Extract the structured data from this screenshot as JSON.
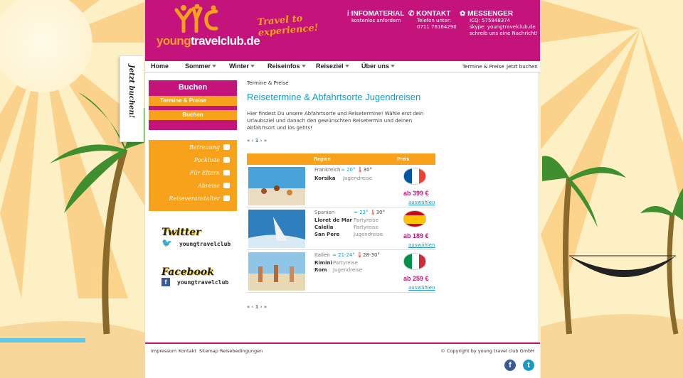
{
  "brand": {
    "logo_left": "young",
    "logo_mid": "travel",
    "logo_right": "club.de",
    "slogan": "Travel to experience!"
  },
  "header": {
    "info": {
      "title": "INFOMATERIAL",
      "sub": "kostenlos anfordern"
    },
    "contact": {
      "title": "KONTAKT",
      "line1": "Telefon unter:",
      "line2": "0711 76164290"
    },
    "messenger": {
      "title": "MESSENGER",
      "line1": "ICQ: 575848374",
      "line2": "skype: youngtravelclub.de",
      "line3": "schreib uns eine Nachricht!"
    }
  },
  "nav": {
    "items": [
      "Home",
      "Sommer",
      "Winter",
      "Reiseinfos",
      "Reiseziel",
      "Über uns"
    ],
    "right": [
      "Termine & Preise",
      "Jetzt buchen"
    ]
  },
  "side_tab": "Jetzt buchen!",
  "sidebar": {
    "book_title": "Buchen",
    "book_items": [
      "Termine & Preise",
      "Buchen"
    ],
    "info_items": [
      "Betreuung",
      "Packliste",
      "Für Eltern",
      "Abreise",
      "Reiseveranstalter"
    ],
    "twitter": {
      "title": "Twitter",
      "handle": "youngtravelclub"
    },
    "facebook": {
      "title": "Facebook",
      "handle": "youngtravelclub"
    }
  },
  "content": {
    "breadcrumb": "Termine & Preise",
    "title": "Reisetermine & Abfahrtsorte Jugendreisen",
    "intro": "Hier findest Du unsere Abfahrtsorte und Reisetermine! Wähle erst dein Urlaubsziel und danach den gewünschten Reisetermin und deinen Abfahrtsort und los gehts!",
    "pager": {
      "first": "«",
      "prev": "‹",
      "current": "1",
      "next": "›",
      "last": "»"
    },
    "table": {
      "col_region": "Region",
      "col_price": "Preis",
      "rows": [
        {
          "country": "Frankreich",
          "water": "≈ 20°",
          "air": "30°",
          "dests": [
            {
              "name": "Korsika",
              "type": "Jugendreise"
            }
          ],
          "price": "ab 399 €",
          "choose": "auswählen",
          "flag": [
            "#0055a4",
            "#ffffff",
            "#ef4135"
          ]
        },
        {
          "country": "Spanien",
          "water": "≈ 23°",
          "air": "30°",
          "dests": [
            {
              "name": "Lloret de Mar",
              "type": "Partyreise"
            },
            {
              "name": "Calella",
              "type": "Partyreise"
            },
            {
              "name": "San Pere",
              "type": "Jugendreise"
            }
          ],
          "price": "ab 189 €",
          "choose": "auswählen",
          "flag": [
            "#c60b1e",
            "#ffc400",
            "#c60b1e"
          ]
        },
        {
          "country": "Italien",
          "water": "≈ 21-24°",
          "air": "28-30°",
          "dests": [
            {
              "name": "Rimini",
              "type": "Partyreise"
            },
            {
              "name": "Rom",
              "type": "Jugendreise"
            }
          ],
          "price": "ab 259 €",
          "choose": "auswählen",
          "flag": [
            "#009246",
            "#ffffff",
            "#ce2b37"
          ]
        }
      ]
    }
  },
  "footer": {
    "links": [
      "Impressum",
      "Kontakt",
      "Sitemap",
      "Reisebedingungen"
    ],
    "copyright": "© Copyright by young travel club GmbH",
    "icons": [
      "f",
      "t"
    ]
  },
  "colors": {
    "magenta": "#c4147c",
    "orange": "#f7a21a",
    "blue": "#1b9ac8"
  }
}
